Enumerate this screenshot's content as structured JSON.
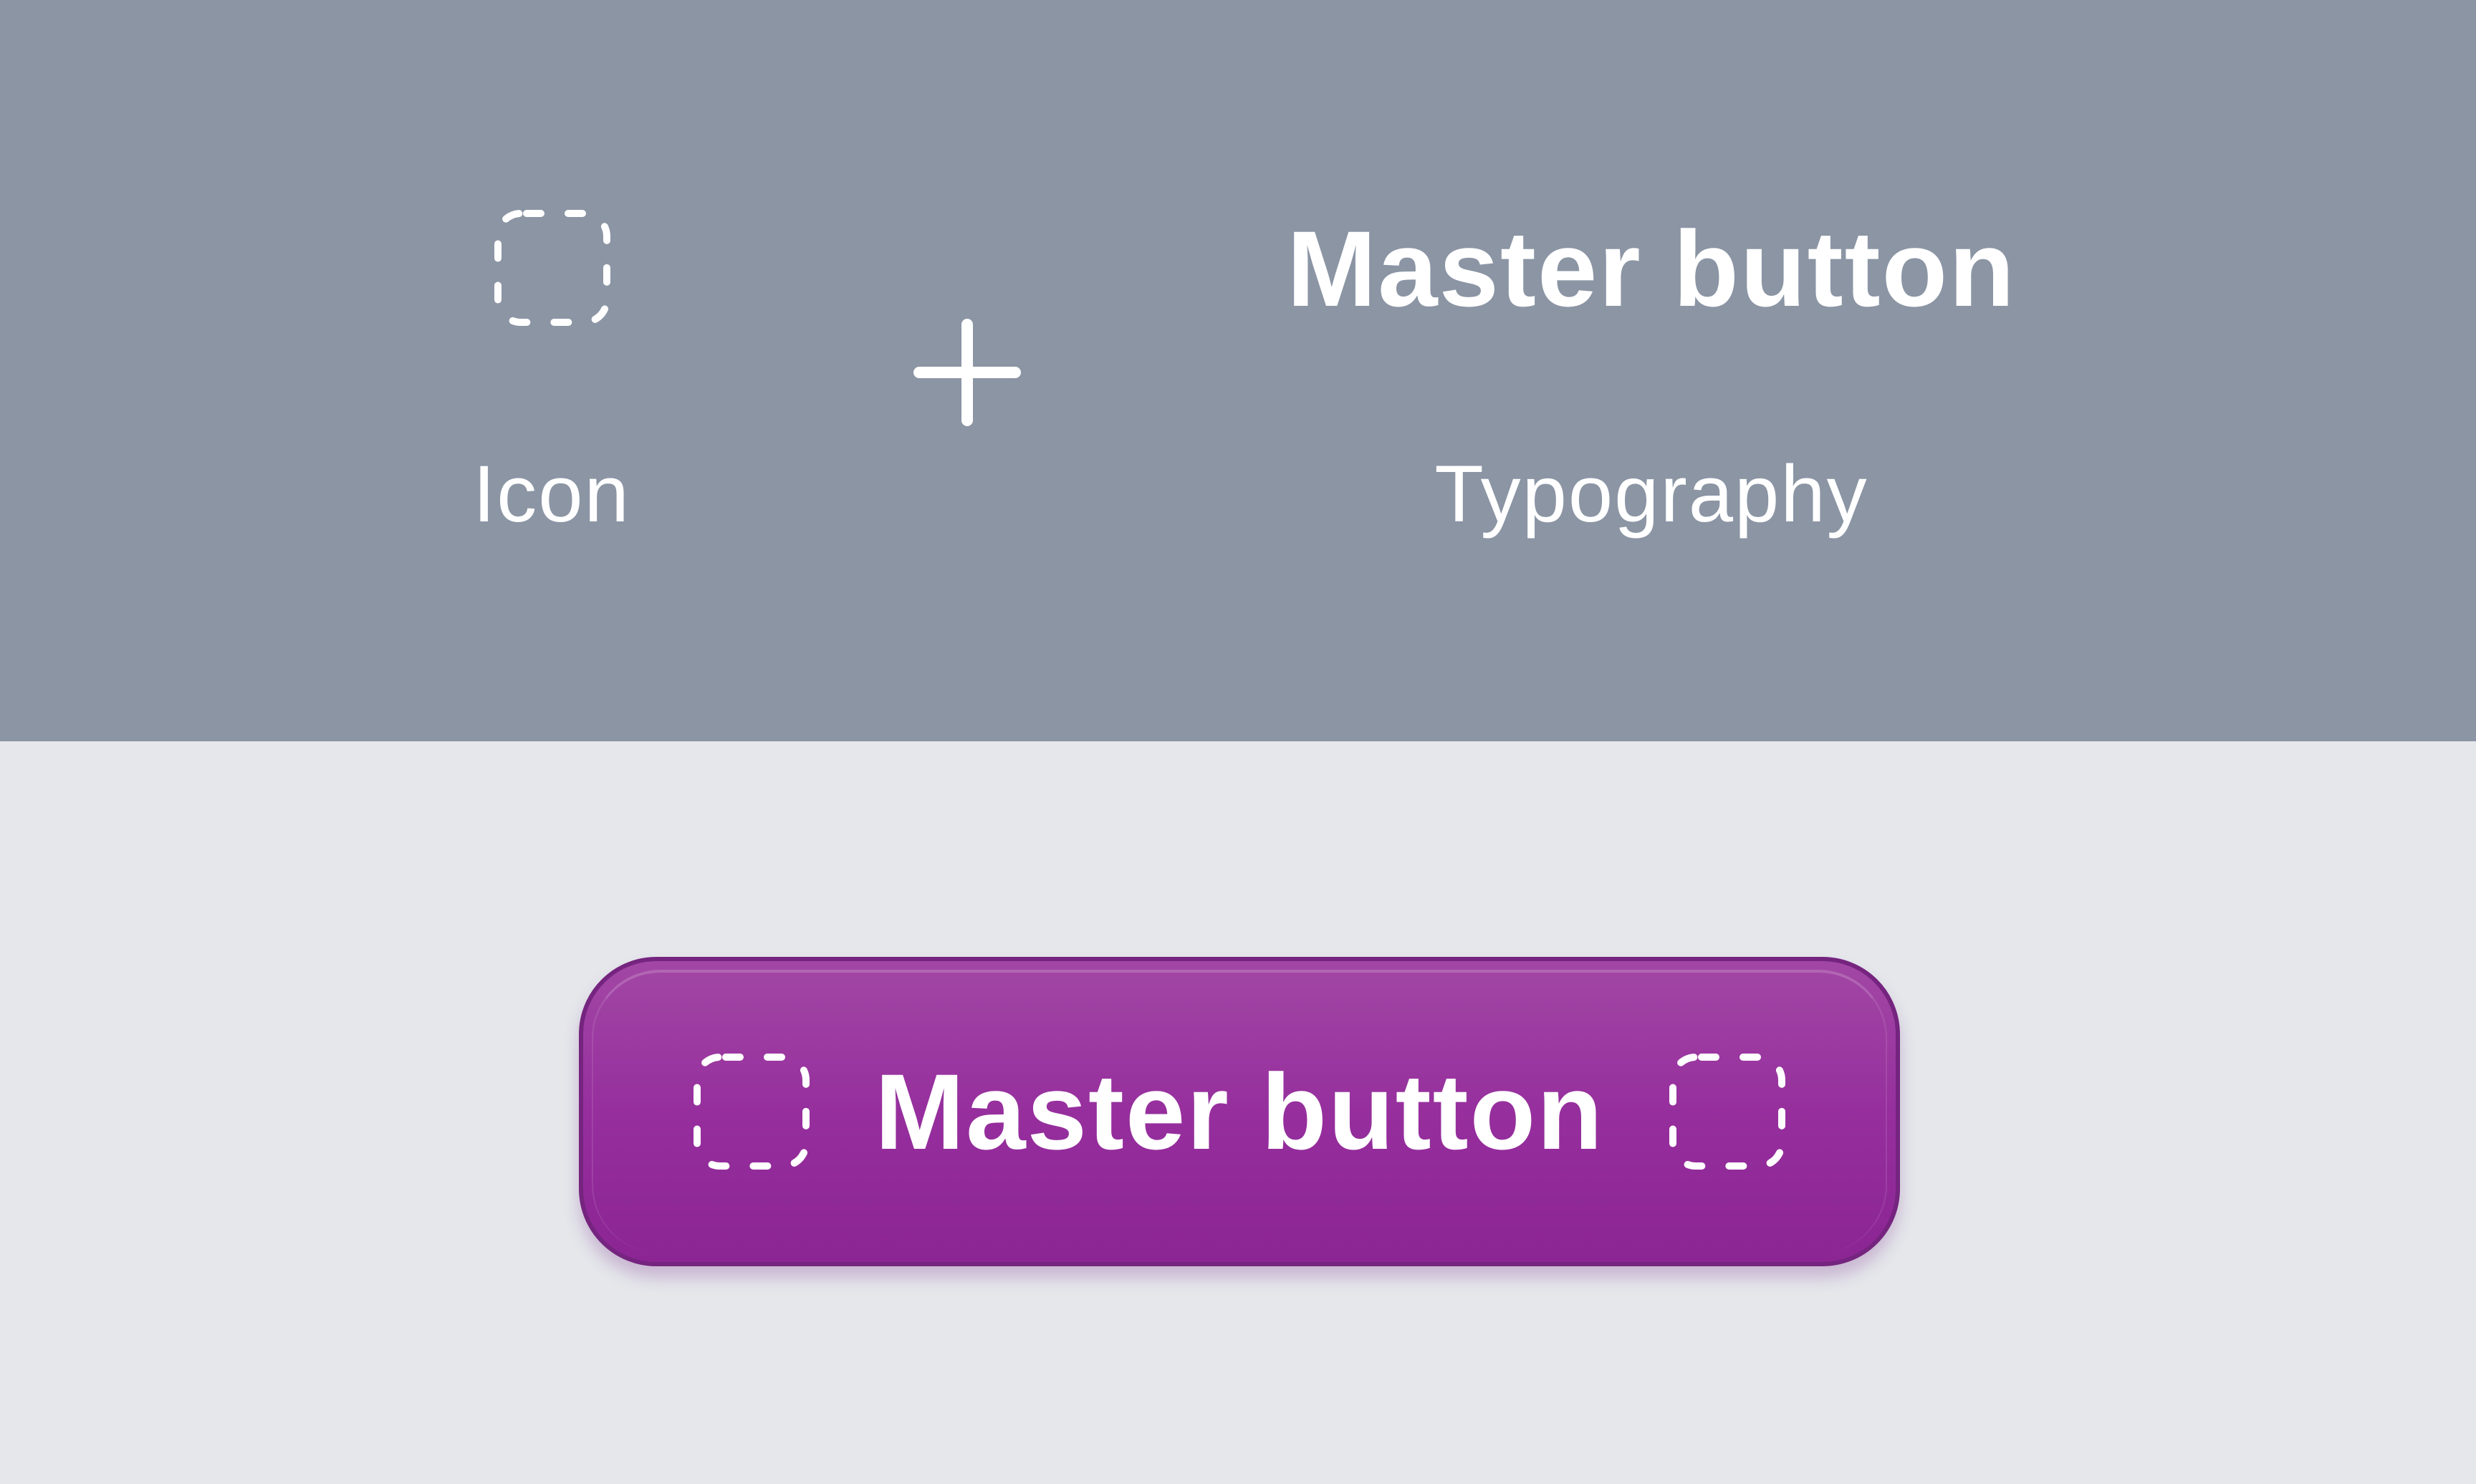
{
  "legend": {
    "icon_label": "Icon",
    "title": "Master button",
    "typography_label": "Typography",
    "icons": {
      "placeholder": "dashed-square-icon",
      "combine": "plus-icon"
    }
  },
  "button": {
    "label": "Master button",
    "leading_icon": "dashed-square-icon",
    "trailing_icon": "dashed-square-icon"
  },
  "colors": {
    "top_panel": "#8b95a4",
    "bottom_panel": "#e5e7eb",
    "button_fill": "#962f9d",
    "button_border": "#75247f",
    "text": "#ffffff"
  }
}
